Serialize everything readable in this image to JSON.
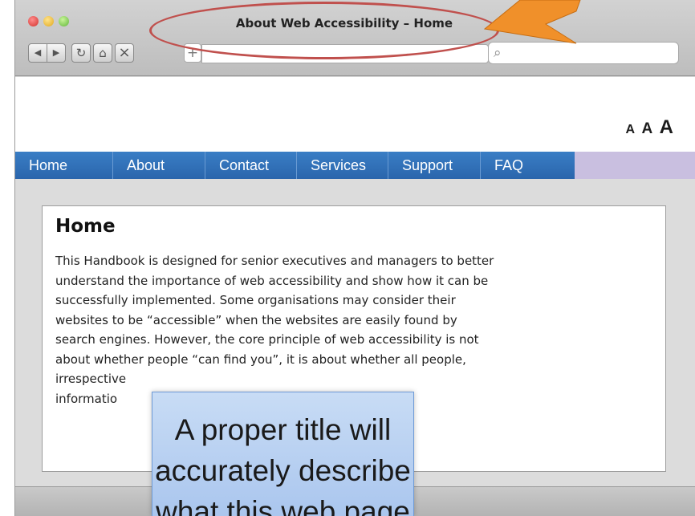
{
  "window": {
    "title": "About Web Accessibility – Home"
  },
  "toolbar": {
    "back_icon": "back-arrow-icon",
    "forward_icon": "forward-arrow-icon",
    "reload_icon": "reload-icon",
    "home_icon": "home-icon",
    "stop_icon": "close-icon",
    "add_icon": "plus-icon",
    "search_icon": "search-icon",
    "back_glyph": "◀",
    "forward_glyph": "▶",
    "reload_glyph": "↻",
    "home_glyph": "⌂",
    "stop_glyph": "×",
    "plus_glyph": "+",
    "search_glyph": "⌕"
  },
  "header": {
    "text_size": [
      "A",
      "A",
      "A"
    ]
  },
  "nav": {
    "items": [
      "Home",
      "About",
      "Contact",
      "Services",
      "Support",
      "FAQ"
    ]
  },
  "content": {
    "heading": "Home",
    "lines": [
      "This Handbook is designed for senior executives and managers to better",
      "understand the importance of web accessibility and show how it can be",
      "successfully implemented. Some organisations may consider their",
      "websites to be “accessible” when the websites are easily found by",
      "search engines. However, the core principle of web accessibility is not",
      "about whether people “can find you”, it is about whether all people,",
      "irrespective",
      "informatio"
    ]
  },
  "callout": {
    "lines": [
      "A proper title will",
      "accurately describe",
      "what this web page"
    ]
  },
  "colors": {
    "nav_blue": "#2f70b7",
    "nav_rest": "#c9bfe0",
    "annotation_ellipse": "#c0504d",
    "annotation_arrow": "#f0902a",
    "callout_fill": "#b8d0f1"
  }
}
